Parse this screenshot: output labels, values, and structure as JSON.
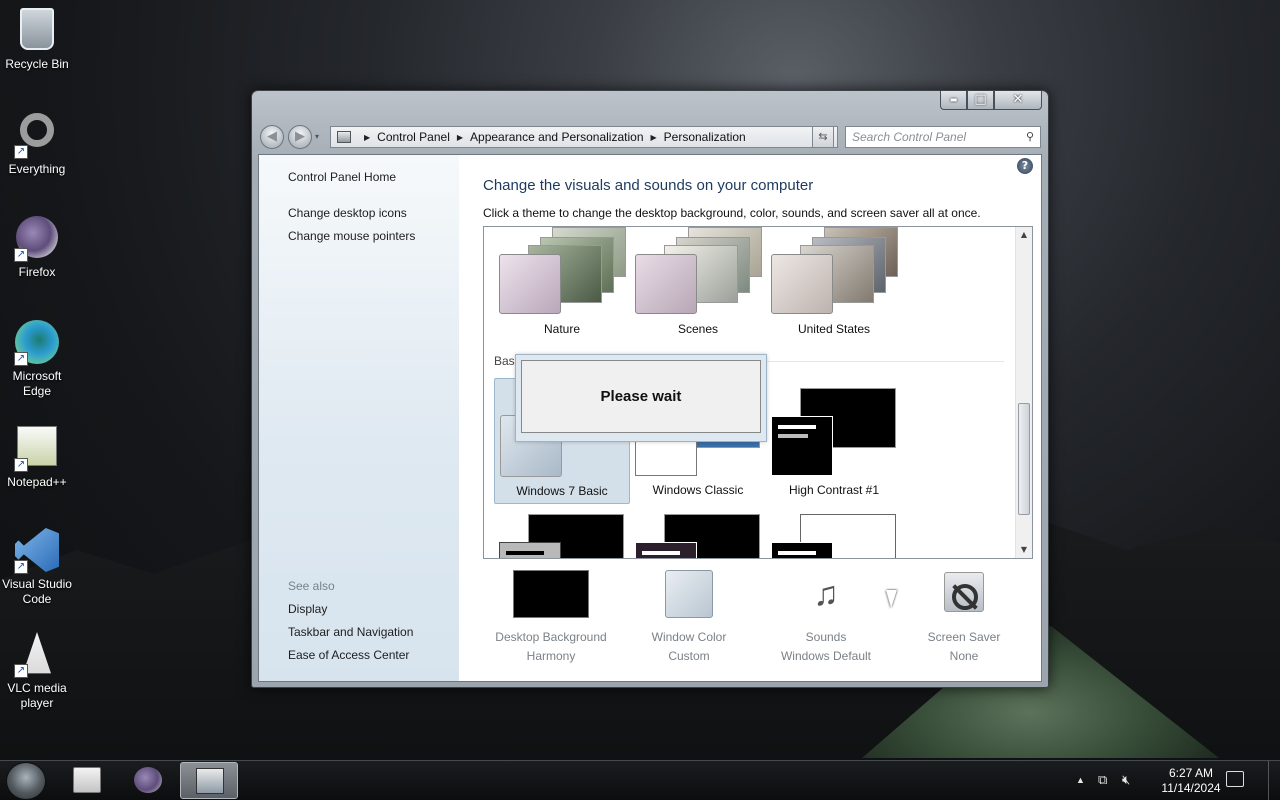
{
  "desktop": {
    "icons": [
      {
        "label": "Recycle Bin",
        "icon": "recycle-bin-icon"
      },
      {
        "label": "Everything",
        "icon": "everything-icon"
      },
      {
        "label": "Firefox",
        "icon": "firefox-icon"
      },
      {
        "label": "Microsoft Edge",
        "icon": "edge-icon"
      },
      {
        "label": "Notepad++",
        "icon": "notepad-plus-plus-icon"
      },
      {
        "label": "Visual Studio Code",
        "icon": "vscode-icon"
      },
      {
        "label": "VLC media player",
        "icon": "vlc-icon"
      }
    ]
  },
  "window": {
    "controls": {
      "minimize": "▬",
      "maximize": "□",
      "close": "✕"
    },
    "breadcrumb": [
      "Control Panel",
      "Appearance and Personalization",
      "Personalization"
    ],
    "search_placeholder": "Search Control Panel",
    "help": "?",
    "sidebar": {
      "links": [
        "Control Panel Home",
        "Change desktop icons",
        "Change mouse pointers"
      ],
      "see_also_heading": "See also",
      "see_also_links": [
        "Display",
        "Taskbar and Navigation",
        "Ease of Access Center"
      ]
    },
    "main": {
      "title": "Change the visuals and sounds on your computer",
      "subtitle": "Click a theme to change the desktop background, color, sounds, and screen saver all at once.",
      "aero_themes": [
        "Nature",
        "Scenes",
        "United States"
      ],
      "basic_group_label": "Basi",
      "basic_themes": [
        "Windows 7 Basic",
        "Windows Classic",
        "High Contrast #1"
      ],
      "selected_theme": "Windows 7 Basic",
      "wait_message": "Please wait",
      "bottom": [
        {
          "label": "Desktop Background",
          "value": "Harmony"
        },
        {
          "label": "Window Color",
          "value": "Custom"
        },
        {
          "label": "Sounds",
          "value": "Windows Default"
        },
        {
          "label": "Screen Saver",
          "value": "None"
        }
      ]
    }
  },
  "taskbar": {
    "time": "6:27 AM",
    "date": "11/14/2024",
    "tray_icons": [
      "show-hidden-icons-chevron",
      "network-icon",
      "volume-muted-icon"
    ]
  }
}
